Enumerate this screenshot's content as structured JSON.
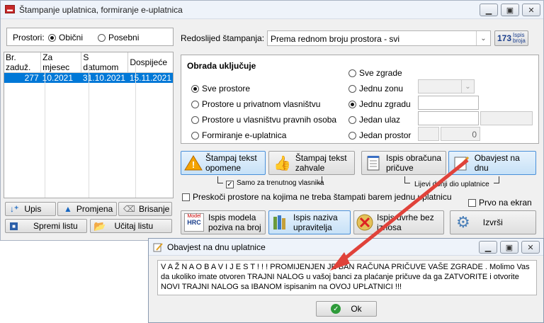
{
  "main": {
    "title": "Štampanje uplatnica, formiranje e-uplatnica",
    "prostori_label": "Prostori:",
    "prostori_options": [
      "Obični",
      "Posebni"
    ],
    "prostori_selected": "Obični",
    "table": {
      "headers": [
        "Br. zaduž.",
        "Za mjesec",
        "S datumom",
        "Dospijeće"
      ],
      "rows": [
        [
          "277",
          "10.2021",
          "31.10.2021",
          "15.11.2021"
        ]
      ]
    },
    "redoslijed_label": "Redoslijed štampanja:",
    "redoslijed_value": "Prema rednom broju prostora - svi",
    "ispis_broja": {
      "num": "173",
      "line1": "Ispis",
      "line2": "broja"
    },
    "obrada_title": "Obrada uključuje",
    "left_options": [
      "Sve prostore",
      "Prostore u privatnom vlasništvu",
      "Prostore u vlasništvu pravnih osoba",
      "Formiranje e-uplatnica"
    ],
    "left_selected": "Sve prostore",
    "right_options": [
      "Sve zgrade",
      "Jednu zonu",
      "Jednu zgradu",
      "Jedan ulaz",
      "Jedan prostor"
    ],
    "right_selected": "Jednu zgradu",
    "jedan_prostor_value": "0",
    "buttons": {
      "upis": "Upis",
      "promjena": "Promjena",
      "brisanje": "Brisanje",
      "spremi": "Spremi listu",
      "ucitaj": "Učitaj listu",
      "opomene": [
        "Štampaj tekst",
        "opomene"
      ],
      "zahvale": [
        "Štampaj tekst",
        "zahvale"
      ],
      "obracuna": [
        "Ispis obračuna",
        "pričuve"
      ],
      "obavjest": "Obavjest na dnu",
      "modela": [
        "Ispis modela",
        "poziva na broj"
      ],
      "naziva": [
        "Ispis naziva",
        "upravitelja"
      ],
      "bez": [
        "Ispis uvrhe bez",
        "iznosa"
      ],
      "izvrsi": "Izvrši"
    },
    "samo_label": "Samo za trenutnog vlasnika",
    "samo_checked": true,
    "lijevi_label": "Lijevi donji dio uplatnice",
    "preskoci_label": "Preskoči prostore na kojima ne treba štampati barem jednu uplatnicu",
    "preskoci_checked": false,
    "prvo_label": "Prvo na ekran",
    "prvo_checked": false,
    "hrc_top": "Model",
    "hrc_text": "HRC"
  },
  "popup": {
    "title": "Obavjest na dnu uplatnice",
    "message": "V A Ž N A   O B A V I J E S T ! ! ! PROMIJENJEN JE BAN RAČUNA PRIČUVE VAŠE ZGRADE . Molimo Vas da ukoliko imate otvoren TRAJNI NALOG u vašoj banci za plaćanje pričuve da ga ZATVORITE i otvorite NOVI TRAJNI NALOG  sa IBANOM ispisanim na OVOJ UPLATNICI !!!",
    "ok_label": "Ok"
  },
  "colors": {
    "selection": "#0078d7",
    "highlight_border": "#4a90d9",
    "arrow": "#e0423a",
    "title_bg": "#eef3fa"
  },
  "icons": [
    "app-icon",
    "minimize-icon",
    "maximize-icon",
    "close-icon",
    "chevron-down-icon",
    "warning-icon",
    "thumbs-up-icon",
    "notepad-icon",
    "pencil-icon",
    "hrc-model-icon",
    "books-icon",
    "cancel-x-icon",
    "gear-icon",
    "down-arrow-icon",
    "triangle-up-icon",
    "eraser-icon",
    "save-icon",
    "open-folder-icon",
    "ok-check-icon"
  ]
}
